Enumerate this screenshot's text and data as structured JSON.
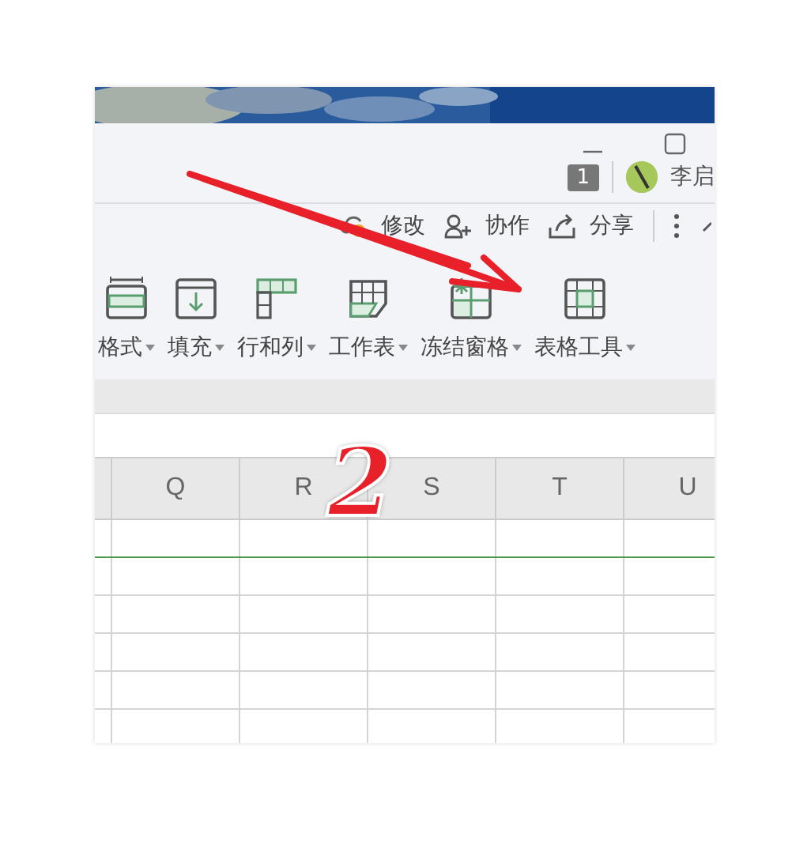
{
  "title_bar": {
    "badge": "1",
    "user_name": "李启"
  },
  "toolbar": [
    {
      "kind": "status",
      "label": "修改"
    },
    {
      "kind": "collab",
      "label": "协作"
    },
    {
      "kind": "share",
      "label": "分享"
    }
  ],
  "ribbon": [
    {
      "label": "格式"
    },
    {
      "label": "填充"
    },
    {
      "label": "行和列"
    },
    {
      "label": "工作表"
    },
    {
      "label": "冻结窗格"
    },
    {
      "label": "表格工具"
    }
  ],
  "sheet": {
    "columns": [
      "Q",
      "R",
      "S",
      "T",
      "U"
    ]
  },
  "annotation": {
    "label": "2"
  }
}
